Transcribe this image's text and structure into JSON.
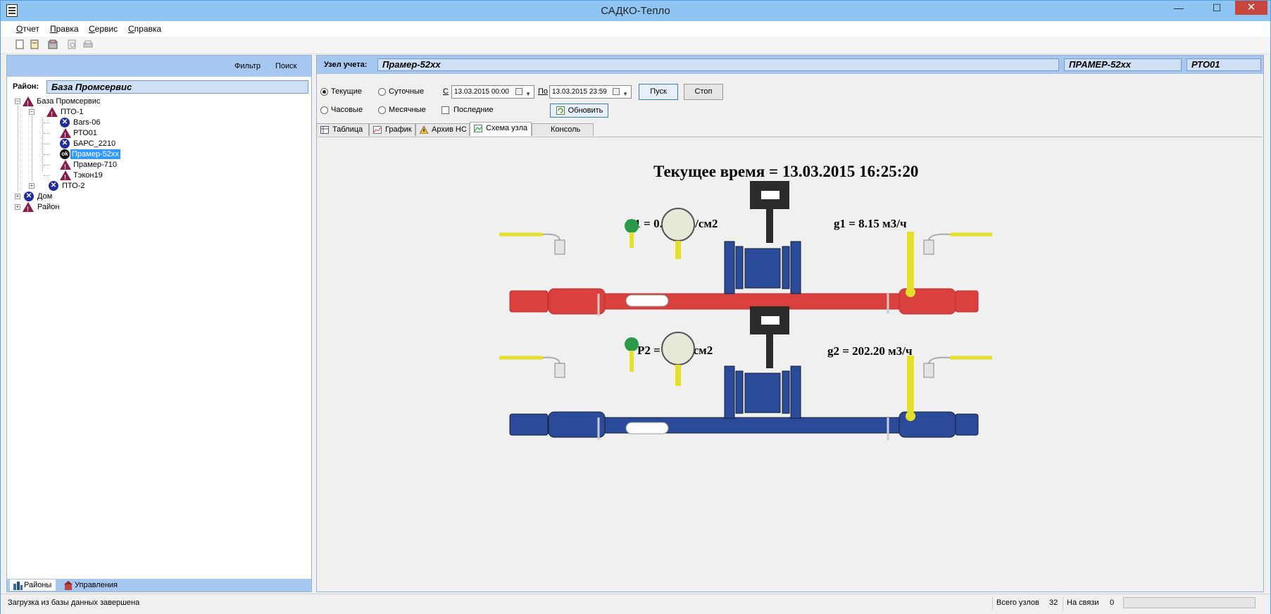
{
  "window": {
    "title": "САДКО-Тепло",
    "min": "—",
    "max": "☐",
    "close": "✕"
  },
  "menu": [
    "Отчет",
    "Правка",
    "Сервис",
    "Справка"
  ],
  "left": {
    "filter": "Фильтр",
    "search": "Поиск",
    "raion_label": "Район:",
    "raion_value": "База Промсервис",
    "tree": {
      "root": "База Промсервис",
      "pto1": "ПТО-1",
      "bars06": "Bars-06",
      "pto01": "РТО01",
      "bars2210": "БАРС_2210",
      "pramer52": "Прамер-52хх",
      "ok": "ok",
      "pramer710": "Прамер-710",
      "tekon19": "Тэкон19",
      "pto2": "ПТО-2",
      "dom": "Дом",
      "raion": "Район"
    },
    "tabs": [
      "Районы",
      "Управления"
    ]
  },
  "right": {
    "uzel_label": "Узел учета:",
    "uzel_name": "Прамер-52хх",
    "uzel_code": "ПРАМЕР-52хх",
    "uzel_pto": "РТО01",
    "radios": {
      "current": "Текущие",
      "daily": "Суточные",
      "hourly": "Часовые",
      "monthly": "Месячные"
    },
    "from_label": "С",
    "from_date": "13.03.2015 00:00",
    "to_label": "По",
    "to_date": "13.03.2015 23:59",
    "last": "Последние",
    "start": "Пуск",
    "stop": "Стоп",
    "refresh": "Обновить",
    "tabs": [
      "Таблица",
      "График",
      "Архив НС",
      "Схема узла",
      "Консоль НС"
    ]
  },
  "scheme": {
    "current_time": "Текущее время = 13.03.2015 16:25:20",
    "p1": "P1 = 0.36 кгс/см2",
    "g1": "g1 = 8.15 м3/ч",
    "p2": "P2 = 0 кгс/см2",
    "g2": "g2 = 202.20 м3/ч",
    "colors": {
      "supply": "#d9403e",
      "return": "#2b4a9a",
      "valve": "#e6e02a",
      "gauge": "#e8e8d8",
      "meter": "#2b2b2b"
    }
  },
  "status": {
    "message": "Загрузка из базы данных завершена",
    "total_label": "Всего узлов",
    "total": "32",
    "online_label": "На связи",
    "online": "0"
  }
}
